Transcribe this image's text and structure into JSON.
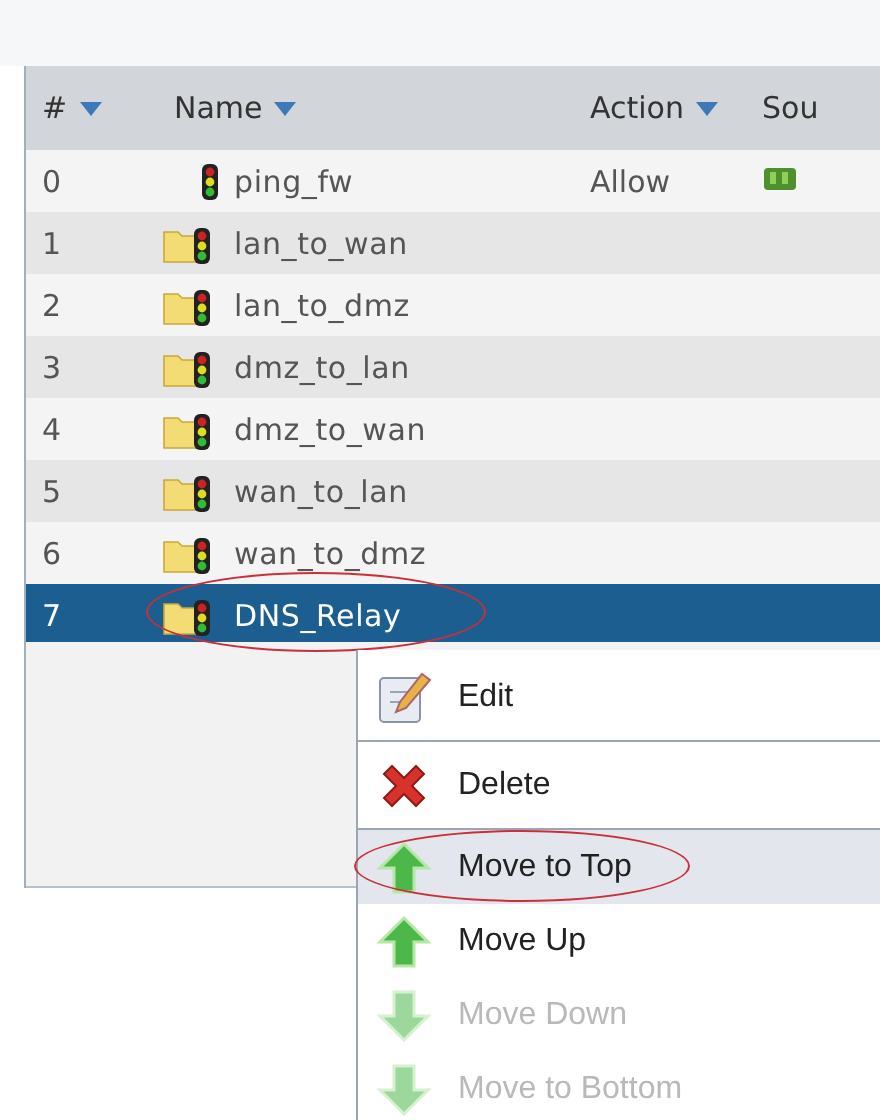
{
  "table": {
    "columns": [
      {
        "label": "#",
        "sort_caret": true
      },
      {
        "label": "Name",
        "sort_caret": true
      },
      {
        "label": "Action",
        "sort_caret": true
      },
      {
        "label": "Sou",
        "sort_caret": false
      }
    ],
    "rows": [
      {
        "number": "0",
        "kind": "rule",
        "name": "ping_fw",
        "action": "Allow",
        "source_icon": true,
        "selected": false,
        "circled": false
      },
      {
        "number": "1",
        "kind": "folder",
        "name": "lan_to_wan",
        "selected": false,
        "circled": false
      },
      {
        "number": "2",
        "kind": "folder",
        "name": "lan_to_dmz",
        "selected": false,
        "circled": false
      },
      {
        "number": "3",
        "kind": "folder",
        "name": "dmz_to_lan",
        "selected": false,
        "circled": false
      },
      {
        "number": "4",
        "kind": "folder",
        "name": "dmz_to_wan",
        "selected": false,
        "circled": false
      },
      {
        "number": "5",
        "kind": "folder",
        "name": "wan_to_lan",
        "selected": false,
        "circled": false
      },
      {
        "number": "6",
        "kind": "folder",
        "name": "wan_to_dmz",
        "selected": false,
        "circled": false
      },
      {
        "number": "7",
        "kind": "folder",
        "name": "DNS_Relay",
        "selected": true,
        "circled": true
      }
    ]
  },
  "context_menu": {
    "items": [
      {
        "kind": "edit",
        "label": "Edit",
        "disabled": false,
        "selected": false,
        "circled": false,
        "divider_after": true
      },
      {
        "kind": "delete",
        "label": "Delete",
        "disabled": false,
        "selected": false,
        "circled": false,
        "divider_after": true
      },
      {
        "kind": "up",
        "label": "Move to Top",
        "disabled": false,
        "selected": true,
        "circled": true,
        "divider_after": false
      },
      {
        "kind": "up",
        "label": "Move Up",
        "disabled": false,
        "selected": false,
        "circled": false,
        "divider_after": false
      },
      {
        "kind": "down",
        "label": "Move Down",
        "disabled": true,
        "selected": false,
        "circled": false,
        "divider_after": false
      },
      {
        "kind": "down",
        "label": "Move to Bottom",
        "disabled": true,
        "selected": false,
        "circled": false,
        "divider_after": false
      }
    ]
  }
}
